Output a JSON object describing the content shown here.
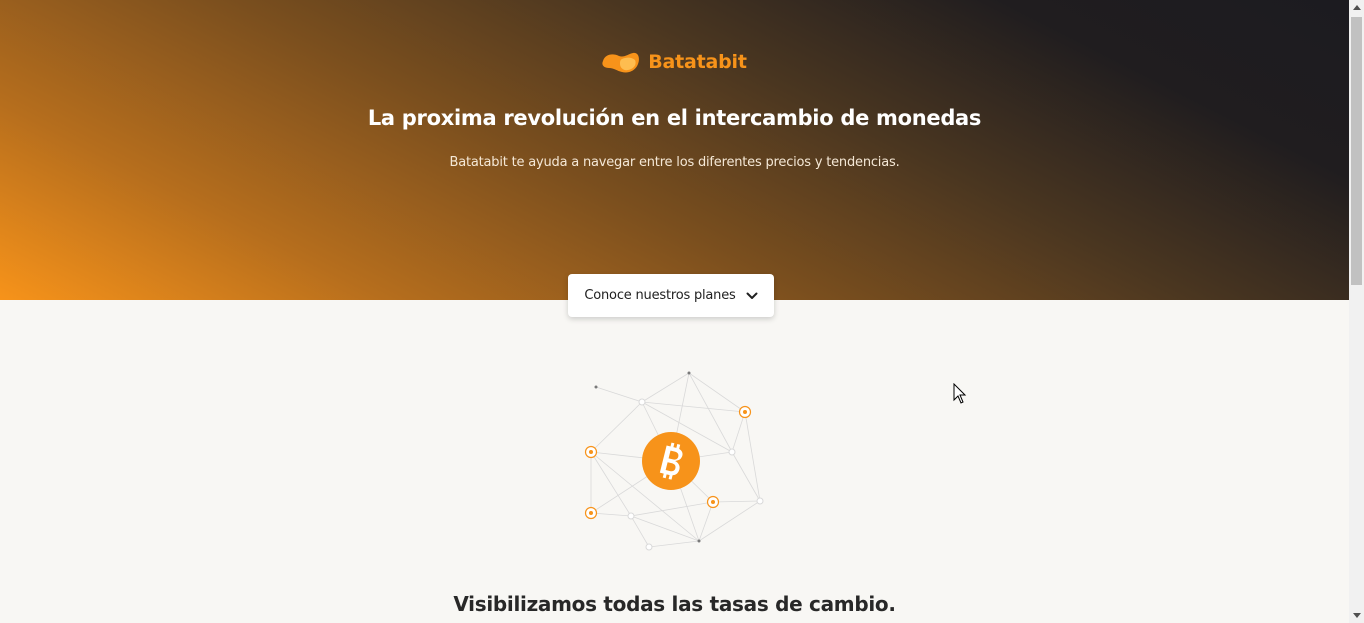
{
  "brand": {
    "name": "Batatabit",
    "accent_color": "#f7931a"
  },
  "hero": {
    "headline": "La proxima revolución en el intercambio de monedas",
    "subtitle": "Batatabit te ayuda a navegar entre los diferentes precios y tendencias.",
    "plans_button": {
      "label": "Conoce nuestros planes",
      "icon": "chevron-down-icon"
    }
  },
  "main": {
    "illustration": "bitcoin-network-icon",
    "section_title": "Visibilizamos todas las tasas de cambio."
  },
  "scrollbar": {
    "up_icon": "scroll-up-icon",
    "down_icon": "scroll-down-icon"
  }
}
